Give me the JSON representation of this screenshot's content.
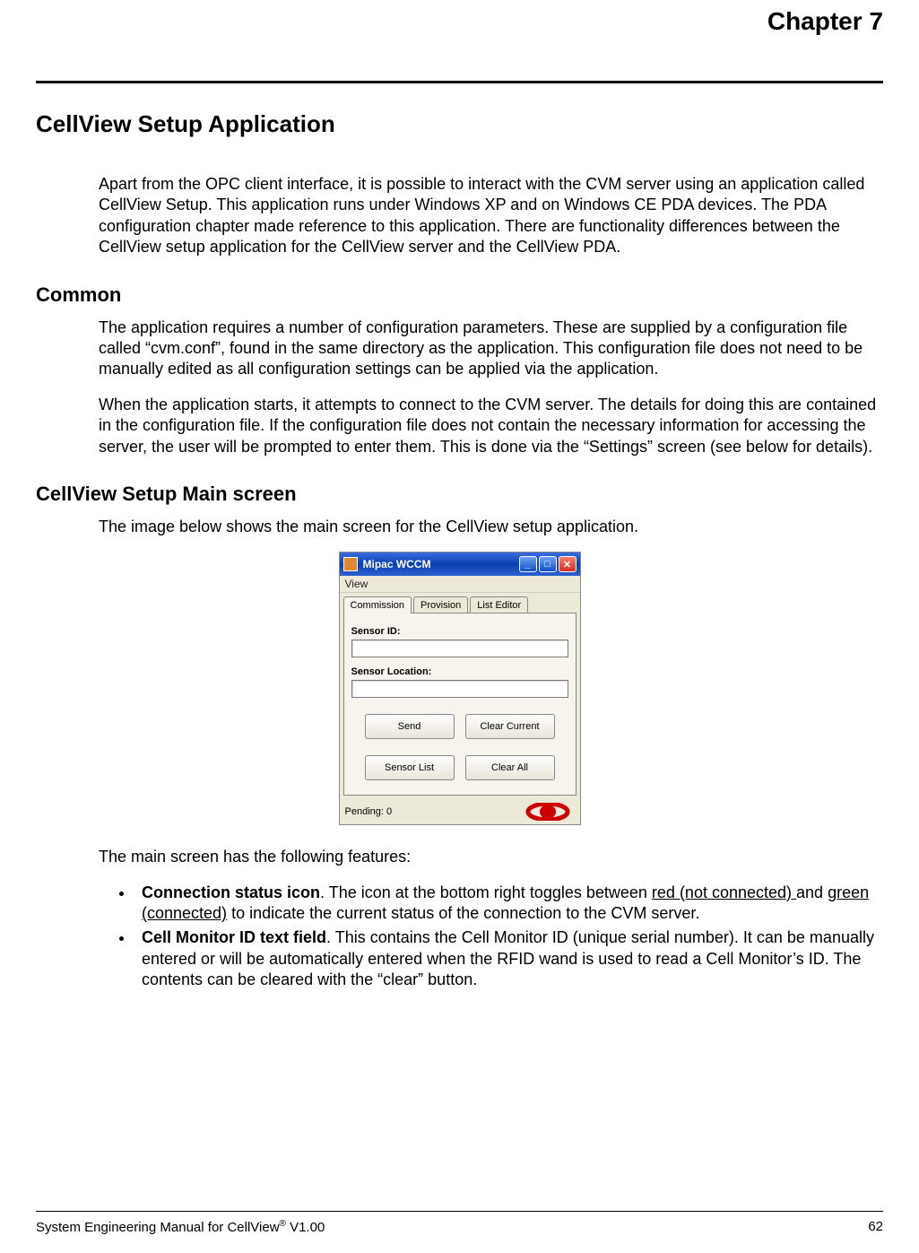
{
  "chapter": "Chapter 7",
  "heading": "CellView Setup Application",
  "intro": "Apart from the OPC client interface, it is possible to interact with the CVM server using an application called CellView Setup.  This application runs under Windows XP and on Windows CE PDA devices.  The PDA configuration chapter made reference to this application.  There are functionality differences between the CellView setup application for the CellView server and the CellView PDA.",
  "section_common": {
    "title": "Common",
    "p1": "The application requires a number of configuration parameters.  These are supplied by a configuration file called “cvm.conf”, found in the same directory as the application.  This configuration file does not need to be manually edited as all configuration settings can be applied via the application.",
    "p2": "When the application starts, it attempts to connect to the CVM server.  The details for doing this are contained in the configuration file.  If the configuration file does not contain the necessary information for accessing the server, the user will be prompted to enter them.  This is done via the “Settings” screen (see below for details)."
  },
  "section_main": {
    "title": "CellView Setup Main screen",
    "intro": "The image below shows the main screen for the CellView setup application.",
    "features_intro": "The main screen has the following features:",
    "features": [
      {
        "bold": "Connection status icon",
        "sep": ".  The icon at the bottom right toggles between ",
        "ul1": "red (not connected) ",
        "mid": "and ",
        "ul2": "green (connected)",
        "rest": " to indicate the current status of the connection to the CVM server."
      },
      {
        "bold": "Cell Monitor ID text field",
        "rest": ".  This contains the Cell Monitor ID (unique serial number).  It can be manually entered or will be automatically entered when the RFID wand is used to read a Cell Monitor’s ID.  The contents can be cleared with the “clear” button."
      }
    ]
  },
  "app": {
    "title": "Mipac WCCM",
    "menu": "View",
    "tabs": [
      "Commission",
      "Provision",
      "List Editor"
    ],
    "label1": "Sensor ID:",
    "label2": "Sensor Location:",
    "buttons": {
      "send": "Send",
      "clear_current": "Clear Current",
      "sensor_list": "Sensor List",
      "clear_all": "Clear All"
    },
    "status": "Pending: 0"
  },
  "footer": {
    "left_a": "System Engineering Manual for CellView",
    "left_b": " V1.00",
    "right": "62"
  }
}
